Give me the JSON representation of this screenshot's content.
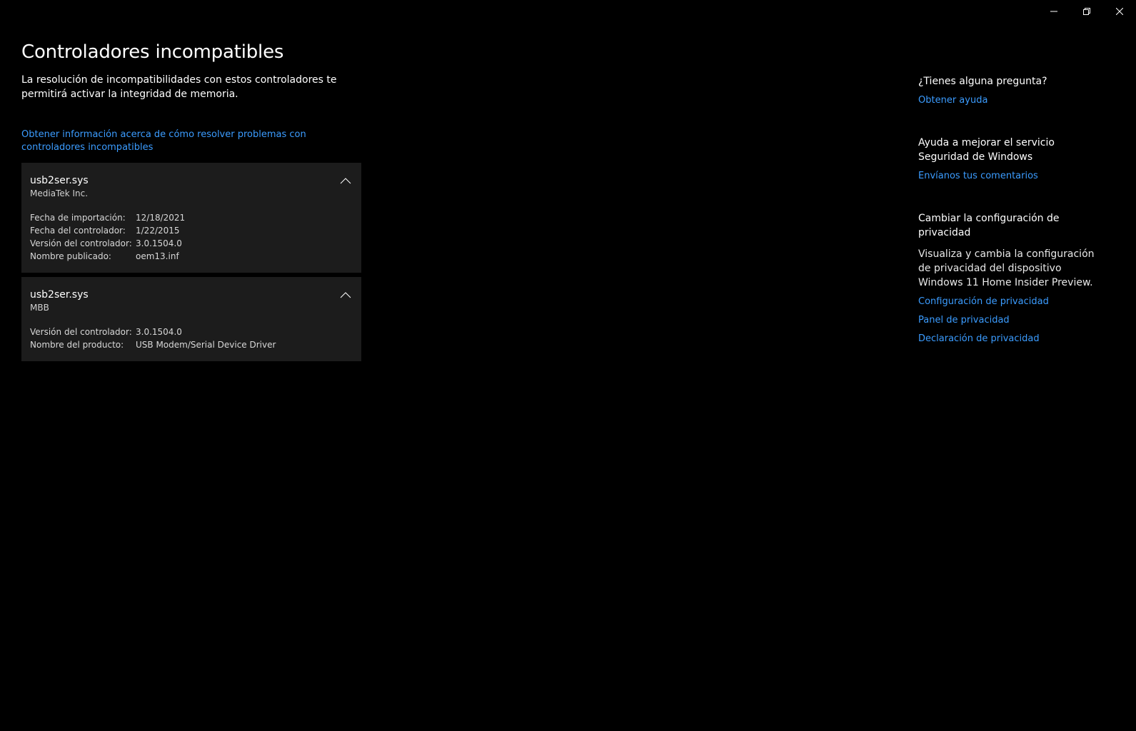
{
  "window": {
    "minimize_icon": "minimize-icon",
    "restore_icon": "restore-icon",
    "close_icon": "close-icon"
  },
  "main": {
    "title": "Controladores incompatibles",
    "description": "La resolución de incompatibilidades con estos controladores te permitirá activar la integridad de memoria.",
    "learn_link": "Obtener información acerca de cómo resolver problemas con controladores incompatibles",
    "drivers": [
      {
        "name": "usb2ser.sys",
        "publisher": "MediaTek Inc.",
        "details": [
          {
            "label": "Fecha de importación:",
            "value": "12/18/2021"
          },
          {
            "label": "Fecha del controlador:",
            "value": "1/22/2015"
          },
          {
            "label": "Versión del controlador:",
            "value": "3.0.1504.0"
          },
          {
            "label": "Nombre publicado:",
            "value": "oem13.inf"
          }
        ]
      },
      {
        "name": "usb2ser.sys",
        "publisher": "MBB",
        "details": [
          {
            "label": "Versión del controlador:",
            "value": "3.0.1504.0"
          },
          {
            "label": "Nombre del producto:",
            "value": "USB Modem/Serial Device Driver"
          }
        ]
      }
    ]
  },
  "side": {
    "question_heading": "¿Tienes alguna pregunta?",
    "help_link": "Obtener ayuda",
    "improve_heading": "Ayuda a mejorar el servicio Seguridad de Windows",
    "feedback_link": "Envíanos tus comentarios",
    "privacy_heading": "Cambiar la configuración de privacidad",
    "privacy_text": "Visualiza y cambia la configuración de privacidad del dispositivo Windows 11 Home Insider Preview.",
    "privacy_links": [
      "Configuración de privacidad",
      "Panel de privacidad",
      "Declaración de privacidad"
    ]
  },
  "colors": {
    "background": "#000000",
    "card": "#1c1c1c",
    "link": "#3b9cff"
  }
}
